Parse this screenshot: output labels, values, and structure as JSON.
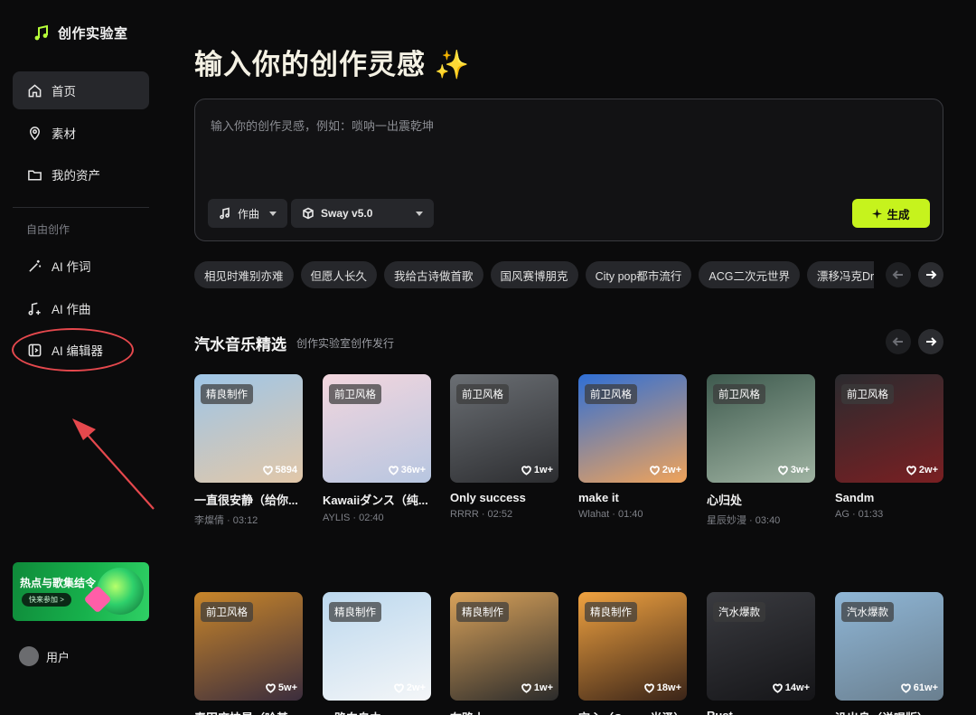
{
  "brand": {
    "name": "创作实验室"
  },
  "sidebar": {
    "items": [
      {
        "label": "首页",
        "icon": "home-icon"
      },
      {
        "label": "素材",
        "icon": "location-pin-icon"
      },
      {
        "label": "我的资产",
        "icon": "folder-icon"
      }
    ],
    "section_label": "自由创作",
    "create_items": [
      {
        "label": "AI 作词",
        "icon": "magic-wand-icon"
      },
      {
        "label": "AI 作曲",
        "icon": "music-plus-icon"
      },
      {
        "label": "AI 编辑器",
        "icon": "editor-icon"
      }
    ],
    "promo": {
      "title": "热点与歌集结令",
      "button": "快来参加 >"
    },
    "user": {
      "label": "用户"
    }
  },
  "main": {
    "headline": "输入你的创作灵感",
    "headline_emoji": "✨",
    "prompt": {
      "placeholder": "输入你的创作灵感，例如：唢呐一出震乾坤",
      "mode_select": "作曲",
      "model_select": "Sway v5.0",
      "generate_label": "生成"
    },
    "chips": [
      "相见时难别亦难",
      "但愿人长久",
      "我给古诗做首歌",
      "国风赛博朋克",
      "City pop都市流行",
      "ACG二次元世界",
      "漂移冯克Drift Phonk"
    ],
    "section": {
      "title": "汽水音乐精选",
      "subtitle": "创作实验室创作发行"
    },
    "cards_row1": [
      {
        "tag": "精良制作",
        "likes": "5894",
        "title": "一直很安静（给你...",
        "meta": "李燦倩 · 03:12",
        "colors": [
          "#9ec6e8",
          "#e2c7a8"
        ]
      },
      {
        "tag": "前卫风格",
        "likes": "36w+",
        "title": "Kawaiiダンス（纯...",
        "meta": "AYLIS · 02:40",
        "colors": [
          "#f3d6de",
          "#b7c6e0"
        ]
      },
      {
        "tag": "前卫风格",
        "likes": "1w+",
        "title": "Only success",
        "meta": "RRRR · 02:52",
        "colors": [
          "#6b6f74",
          "#2c2d30"
        ]
      },
      {
        "tag": "前卫风格",
        "likes": "2w+",
        "title": "make it",
        "meta": "Wlahat · 01:40",
        "colors": [
          "#2f6fd6",
          "#f0a35a"
        ]
      },
      {
        "tag": "前卫风格",
        "likes": "3w+",
        "title": "心归处",
        "meta": "星辰妙漫 · 03:40",
        "colors": [
          "#3e5a4e",
          "#9fb3a2"
        ]
      },
      {
        "tag": "前卫风格",
        "likes": "2w+",
        "title": "Sandm",
        "meta": "AG · 01:33",
        "colors": [
          "#2a2b2f",
          "#7a1f22"
        ]
      }
    ],
    "cards_row2": [
      {
        "tag": "前卫风格",
        "likes": "5w+",
        "colors": [
          "#c9862a",
          "#3b2d3d"
        ]
      },
      {
        "tag": "精良制作",
        "likes": "2w+",
        "colors": [
          "#bcd8ee",
          "#f4f6f8"
        ]
      },
      {
        "tag": "精良制作",
        "likes": "1w+",
        "colors": [
          "#d9a25a",
          "#2b2b2b"
        ]
      },
      {
        "tag": "精良制作",
        "likes": "18w+",
        "colors": [
          "#f0a240",
          "#3a2418"
        ]
      },
      {
        "tag": "汽水爆款",
        "likes": "14w+",
        "colors": [
          "#3a3b40",
          "#151518"
        ]
      },
      {
        "tag": "汽水爆款",
        "likes": "61w+",
        "colors": [
          "#8fb6d6",
          "#6a7f8f"
        ]
      }
    ],
    "row2_titles": [
      "春田麻怯是（哈基",
      "一路向自由",
      "在路上",
      "空心（Cover 光泽）",
      "Rust",
      "没出息（说唱版）"
    ]
  }
}
